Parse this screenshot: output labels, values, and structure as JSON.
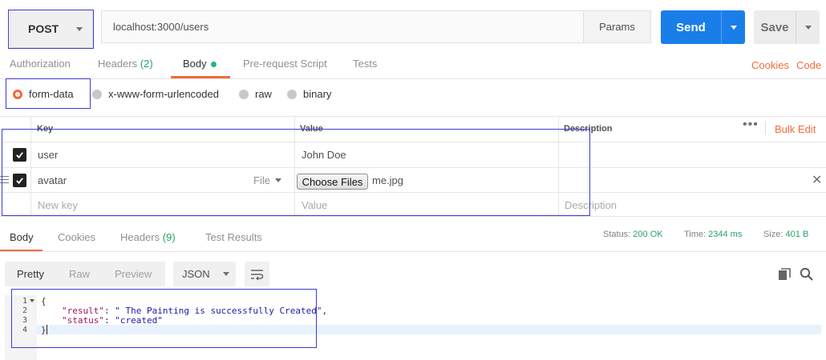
{
  "request": {
    "method": "POST",
    "url": "localhost:3000/users",
    "params_label": "Params",
    "send_label": "Send",
    "save_label": "Save"
  },
  "tabs": [
    {
      "label": "Authorization"
    },
    {
      "label": "Headers",
      "count": "(2)"
    },
    {
      "label": "Body"
    },
    {
      "label": "Pre-request Script"
    },
    {
      "label": "Tests"
    }
  ],
  "links": {
    "cookies": "Cookies",
    "code": "Code"
  },
  "body_types": [
    {
      "label": "form-data",
      "selected": true
    },
    {
      "label": "x-www-form-urlencoded",
      "selected": false
    },
    {
      "label": "raw",
      "selected": false
    },
    {
      "label": "binary",
      "selected": false
    }
  ],
  "form_table": {
    "headers": {
      "key": "Key",
      "value": "Value",
      "description": "Description"
    },
    "bulk_edit": "Bulk Edit",
    "rows": [
      {
        "key": "user",
        "value": "John Doe",
        "checked": true
      },
      {
        "key": "avatar",
        "type": "File",
        "choose_label": "Choose Files",
        "file_name": "me.jpg",
        "checked": true
      }
    ],
    "placeholders": {
      "key": "New key",
      "value": "Value",
      "description": "Description"
    }
  },
  "response": {
    "tabs": [
      {
        "label": "Body"
      },
      {
        "label": "Cookies"
      },
      {
        "label": "Headers",
        "count": "(9)"
      },
      {
        "label": "Test Results"
      }
    ],
    "status": {
      "label": "Status:",
      "value": "200 OK"
    },
    "time": {
      "label": "Time:",
      "value": "2344 ms"
    },
    "size": {
      "label": "Size:",
      "value": "401 B"
    },
    "view_modes": [
      "Pretty",
      "Raw",
      "Preview"
    ],
    "format": "JSON",
    "line_numbers": [
      "1",
      "2",
      "3",
      "4"
    ],
    "code": {
      "open": "{",
      "result_key": "\"result\"",
      "result_value": "\" The Painting is successfully Created\"",
      "status_key": "\"status\"",
      "status_value": "\"created\"",
      "close": "}"
    }
  },
  "colors": {
    "accent": "#f26b3a",
    "send": "#1a7ee8",
    "success": "#26a269",
    "annotation": "#3b3bd6"
  },
  "icons": [
    "caret-down-icon",
    "check-icon",
    "drag-handle-icon",
    "close-icon",
    "more-icon",
    "wrap-icon",
    "copy-icon",
    "search-icon"
  ]
}
